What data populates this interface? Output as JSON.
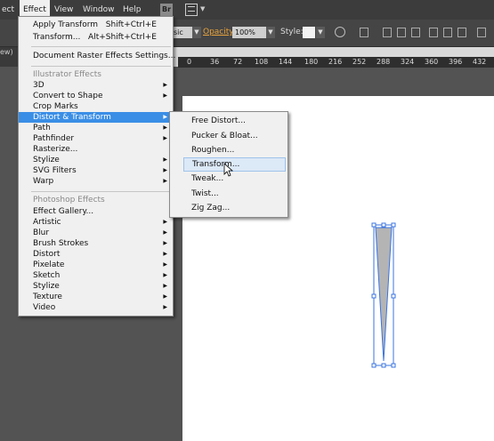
{
  "menubar": {
    "items": [
      {
        "label": "ect"
      },
      {
        "label": "Effect"
      },
      {
        "label": "View"
      },
      {
        "label": "Window"
      },
      {
        "label": "Help"
      }
    ],
    "bridge_label": "Br"
  },
  "controlbar": {
    "blend_value": "sic",
    "opacity_label": "Opacity:",
    "opacity_value": "100%",
    "style_label": "Style:"
  },
  "ruler": {
    "left_label": "ew)",
    "ticks": [
      "0",
      "36",
      "72",
      "108",
      "144",
      "180",
      "216",
      "252",
      "288",
      "324",
      "360",
      "396",
      "432"
    ]
  },
  "effect_menu": {
    "apply_transform": {
      "label": "Apply Transform",
      "shortcut": "Shift+Ctrl+E"
    },
    "transform": {
      "label": "Transform...",
      "shortcut": "Alt+Shift+Ctrl+E"
    },
    "document_raster": "Document Raster Effects Settings...",
    "illustrator_header": "Illustrator Effects",
    "illustrator_items": [
      "3D",
      "Convert to Shape",
      "Crop Marks",
      "Distort & Transform",
      "Path",
      "Pathfinder",
      "Rasterize...",
      "Stylize",
      "SVG Filters",
      "Warp"
    ],
    "photoshop_header": "Photoshop Effects",
    "photoshop_items": [
      "Effect Gallery...",
      "Artistic",
      "Blur",
      "Brush Strokes",
      "Distort",
      "Pixelate",
      "Sketch",
      "Stylize",
      "Texture",
      "Video"
    ]
  },
  "submenu": {
    "items": [
      "Free Distort...",
      "Pucker & Bloat...",
      "Roughen...",
      "Transform...",
      "Tweak...",
      "Twist...",
      "Zig Zag..."
    ]
  },
  "colors": {
    "highlight": "#3a8ee6",
    "menu_bg": "#f0f0f0",
    "opacity_label": "#e8a33c"
  }
}
